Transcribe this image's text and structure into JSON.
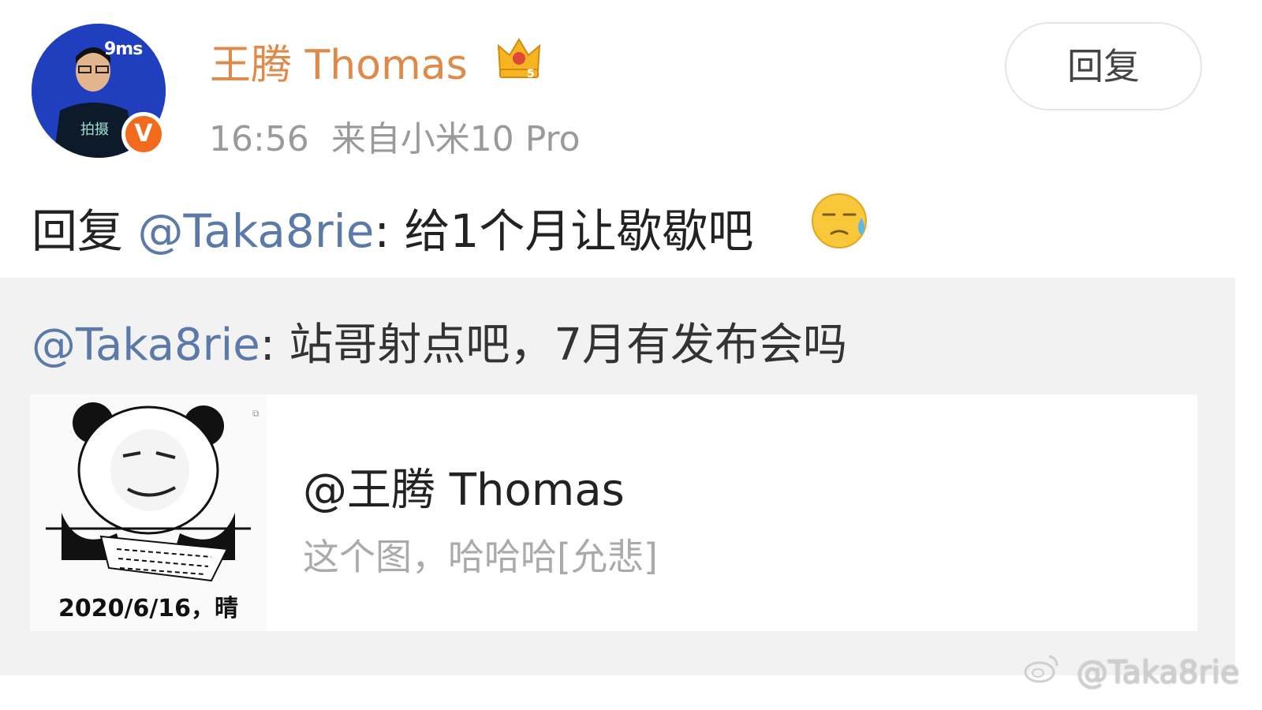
{
  "avatar": {
    "overlay_text": "9ms",
    "badge_text": "V"
  },
  "user": {
    "name": "王腾 Thomas"
  },
  "meta": {
    "time": "16:56",
    "source": "来自小米10 Pro"
  },
  "reply_button": {
    "label": "回复"
  },
  "post": {
    "prefix": "回复 ",
    "mention": "@Taka8rie",
    "text": ": 给1个月让歇歇吧"
  },
  "quote": {
    "mention": "@Taka8rie",
    "text": ": 站哥射点吧，7月有发布会吗"
  },
  "card": {
    "thumb_caption": "2020/6/16，晴",
    "title": "@王腾 Thomas",
    "description": "这个图，哈哈哈[允悲]"
  },
  "watermark": {
    "text": "@Taka8rie"
  },
  "icons": [
    "crown-icon",
    "verified-badge-icon",
    "sweat-emoji-icon",
    "weibo-logo-icon"
  ],
  "colors": {
    "username": "#e08a4a",
    "mention": "#5b7aa8",
    "quote_bg": "#f2f2f2",
    "badge": "#f26a1b"
  }
}
